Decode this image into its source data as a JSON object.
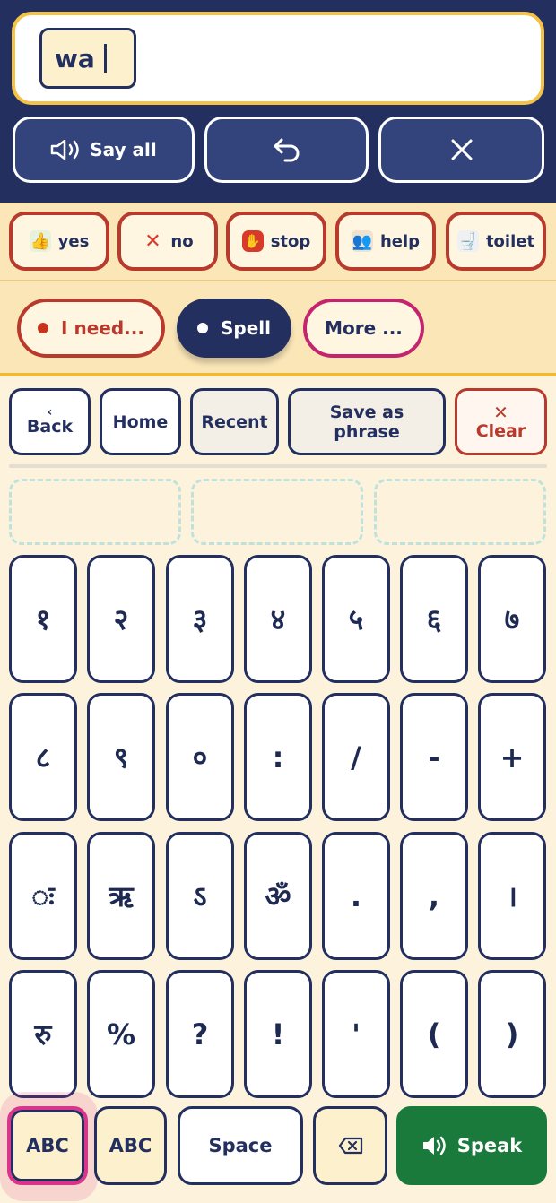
{
  "message": {
    "text": "wa"
  },
  "top_controls": {
    "say_all": "Say all"
  },
  "quick_phrases": [
    {
      "label": "yes",
      "icon": "thumbs-up-icon"
    },
    {
      "label": "no",
      "icon": "red-x-icon"
    },
    {
      "label": "stop",
      "icon": "stop-hand-icon"
    },
    {
      "label": "help",
      "icon": "help-people-icon"
    },
    {
      "label": "toilet",
      "icon": "toilet-icon"
    }
  ],
  "modes": {
    "need": "I need...",
    "spell": "Spell",
    "more": "More ..."
  },
  "nav": {
    "back": "Back",
    "home": "Home",
    "recent": "Recent",
    "save_line1": "Save as",
    "save_line2": "phrase",
    "clear": "Clear"
  },
  "keys": [
    [
      "१",
      "२",
      "३",
      "४",
      "५",
      "६",
      "७"
    ],
    [
      "८",
      "९",
      "०",
      ":",
      "/",
      "-",
      "+"
    ],
    [
      "◌ः",
      "ऋ",
      "ऽ",
      "ॐ",
      ".",
      ",",
      "।"
    ],
    [
      "रु",
      "%",
      "?",
      "!",
      "'",
      "(",
      ")"
    ]
  ],
  "bottom": {
    "abc1": "ABC",
    "abc2": "ABC",
    "space": "Space",
    "speak": "Speak"
  },
  "colors": {
    "navy": "#232f5f",
    "accent_red": "#b83a2c",
    "speak_green": "#1a7a3c",
    "highlight_pink": "#d9368b",
    "cream": "#fdf3dc"
  }
}
